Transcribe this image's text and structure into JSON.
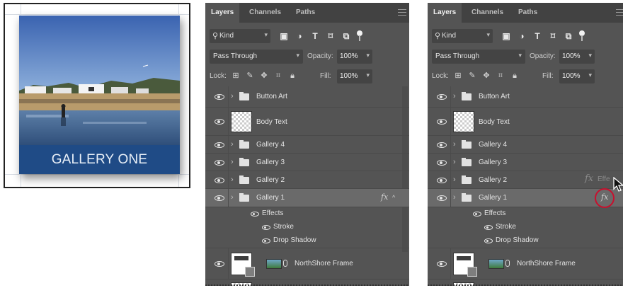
{
  "artwork": {
    "caption": "GALLERY ONE"
  },
  "panels": [
    {
      "tabs": [
        "Layers",
        "Channels",
        "Paths"
      ],
      "filter": {
        "kind_label": "Kind"
      },
      "blend": {
        "mode": "Pass Through",
        "opacity_label": "Opacity:",
        "opacity_value": "100%"
      },
      "lock": {
        "label": "Lock:",
        "fill_label": "Fill:",
        "fill_value": "100%"
      },
      "layers": {
        "button_art": "Button Art",
        "body_text": "Body Text",
        "gallery4": "Gallery 4",
        "gallery3": "Gallery 3",
        "gallery2": "Gallery 2",
        "gallery1": "Gallery 1",
        "effects": "Effects",
        "stroke": "Stroke",
        "drop_shadow": "Drop Shadow",
        "northshore": "NorthShore Frame"
      },
      "fx_symbol": "fx"
    },
    {
      "tabs": [
        "Layers",
        "Channels",
        "Paths"
      ],
      "filter": {
        "kind_label": "Kind"
      },
      "blend": {
        "mode": "Pass Through",
        "opacity_label": "Opacity:",
        "opacity_value": "100%"
      },
      "lock": {
        "label": "Lock:",
        "fill_label": "Fill:",
        "fill_value": "100%"
      },
      "layers": {
        "button_art": "Button Art",
        "body_text": "Body Text",
        "gallery4": "Gallery 4",
        "gallery3": "Gallery 3",
        "gallery2": "Gallery 2",
        "gallery1": "Gallery 1",
        "effects": "Effects",
        "stroke": "Stroke",
        "drop_shadow": "Drop Shadow",
        "northshore": "NorthShore Frame"
      },
      "fx_symbol": "fx",
      "drag_ghost": {
        "fx": "fx",
        "label": "Effe"
      }
    }
  ],
  "colors": {
    "panel_bg": "#545454",
    "tabbar_bg": "#424242",
    "selected_row": "#6a6a6a",
    "caption_bar": "#1f4b86",
    "highlight": "#c8102e"
  }
}
